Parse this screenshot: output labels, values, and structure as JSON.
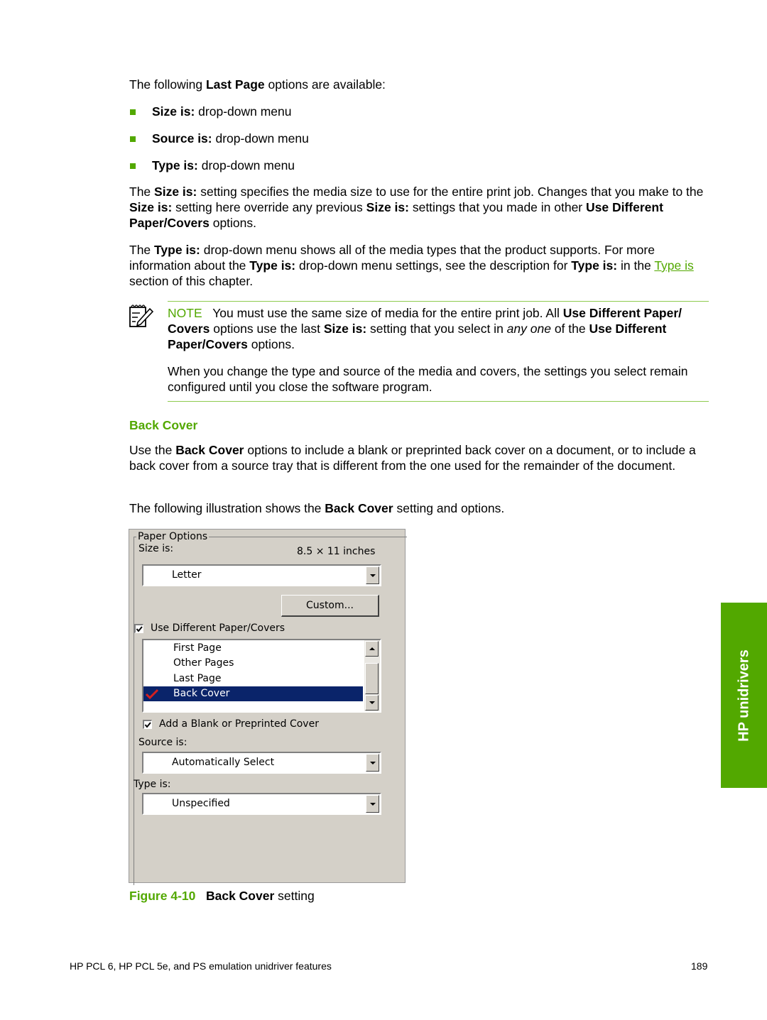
{
  "intro": {
    "prefix": "The following ",
    "bold": "Last Page",
    "suffix": " options are available:"
  },
  "bullets": [
    {
      "bold": "Size is:",
      "text": " drop-down menu"
    },
    {
      "bold": "Source is:",
      "text": " drop-down menu"
    },
    {
      "bold": "Type is:",
      "text": " drop-down menu"
    }
  ],
  "para_size": {
    "t1": "The ",
    "b1": "Size is:",
    "t2": " setting specifies the media size to use for the entire print job. Changes that you make to the ",
    "b2": "Size is:",
    "t3": " setting here override any previous ",
    "b3": "Size is:",
    "t4": " settings that you made in other ",
    "b4": "Use Different Paper/Covers",
    "t5": " options."
  },
  "para_type": {
    "t1": "The ",
    "b1": "Type is:",
    "t2": " drop-down menu shows all of the media types that the product supports. For more information about the ",
    "b2": "Type is:",
    "t3": " drop-down menu settings, see the description for ",
    "b3": "Type is:",
    "t4": " in the ",
    "link": "Type is",
    "t5": " section of this chapter."
  },
  "note": {
    "label": "NOTE",
    "t1": "You must use the same size of media for the entire print job. All ",
    "b1": "Use Different Paper/ Covers",
    "t2": " options use the last ",
    "b2": "Size is:",
    "t3": " setting that you select in ",
    "i1": "any one",
    "t4": " of the ",
    "b3": "Use Different Paper/Covers",
    "t5": " options.",
    "p2": "When you change the type and source of the media and covers, the settings you select remain configured until you close the software program."
  },
  "section": {
    "heading": "Back Cover",
    "p1_t1": "Use the ",
    "p1_b1": "Back Cover",
    "p1_t2": " options to include a blank or preprinted back cover on a document, or to include a back cover from a source tray that is different from the one used for the remainder of the document.",
    "p2_t1": "The following illustration shows the ",
    "p2_b1": "Back Cover",
    "p2_t2": " setting and options."
  },
  "dialog": {
    "group_label": "Paper Options",
    "size_label": "Size is:",
    "size_dims": "8.5 × 11 inches",
    "size_value": "Letter",
    "custom_button": "Custom...",
    "use_different_label": "Use Different Paper/Covers",
    "use_different_checked": true,
    "list_items": [
      {
        "label": "First Page",
        "selected": false,
        "checked": false
      },
      {
        "label": "Other Pages",
        "selected": false,
        "checked": false
      },
      {
        "label": "Last Page",
        "selected": false,
        "checked": false
      },
      {
        "label": "Back Cover",
        "selected": true,
        "checked": true
      }
    ],
    "add_cover_label": "Add a Blank or Preprinted Cover",
    "add_cover_checked": true,
    "source_label": "Source is:",
    "source_value": "Automatically Select",
    "type_label": "Type is:",
    "type_value": "Unspecified"
  },
  "figure": {
    "number": "Figure 4-10",
    "bold": "Back Cover",
    "suffix": " setting"
  },
  "side_tab": "HP unidrivers",
  "footer": {
    "left": "HP PCL 6, HP PCL 5e, and PS emulation unidriver features",
    "page": "189"
  },
  "colors": {
    "accent_green": "#52a800",
    "selection_blue": "#0a246a",
    "dialog_gray": "#d4d0c8"
  }
}
